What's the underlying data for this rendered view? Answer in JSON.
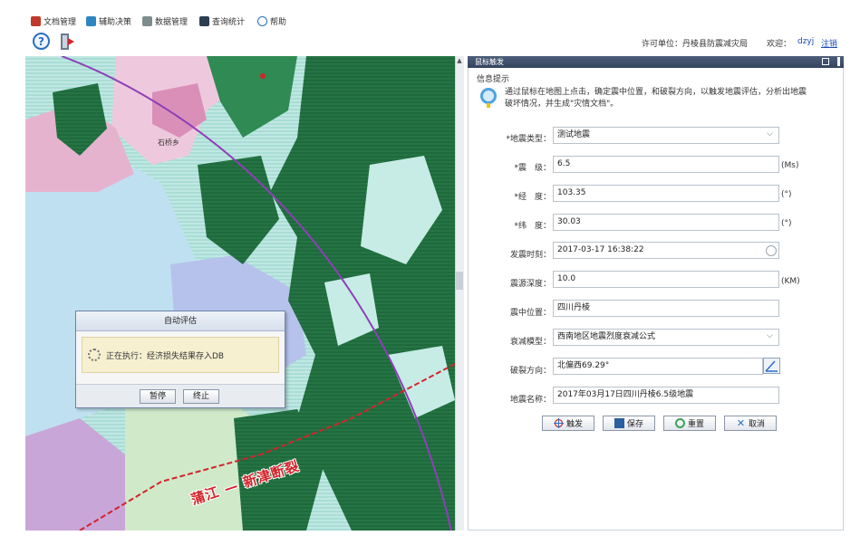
{
  "menu": [
    {
      "label": "文档管理",
      "icon": "document-icon",
      "color": "#c0392b"
    },
    {
      "label": "辅助决策",
      "icon": "decision-icon",
      "color": "#2e86c1"
    },
    {
      "label": "数据管理",
      "icon": "data-icon",
      "color": "#7f8c8d"
    },
    {
      "label": "查询统计",
      "icon": "chart-icon",
      "color": "#2c3e50"
    },
    {
      "label": "帮助",
      "icon": "help-icon",
      "color": "#2a6fc0"
    }
  ],
  "toolbar": {
    "help_glyph": "?",
    "license": "许可单位：丹棱县防震减灾局",
    "welcome": "欢迎：",
    "user": "dzyj",
    "logout": "注销"
  },
  "map": {
    "town_label": "石桥乡",
    "fault_label": "蒲江 — 新津断裂",
    "scroll_up_glyph": "▲"
  },
  "dialog": {
    "title": "自动评估",
    "status": "正在执行：经济损失结果存入DB",
    "pause": "暂停",
    "stop": "终止"
  },
  "panel": {
    "title": "鼠标触发",
    "info_title": "信息提示",
    "info_text": "通过鼠标在地图上点击，确定震中位置，和破裂方向，以触发地震评估，分析出地震破坏情况，并生成\"灾情文档\"。",
    "fields": [
      {
        "label": "*地震类型：",
        "value": "测试地震",
        "unit": "",
        "kind": "select"
      },
      {
        "label": "*震　级：",
        "value": "6.5",
        "unit": "(Ms)",
        "kind": "text"
      },
      {
        "label": "*经　度：",
        "value": "103.35",
        "unit": "(°)",
        "kind": "text"
      },
      {
        "label": "*纬　度：",
        "value": "30.03",
        "unit": "(°)",
        "kind": "text"
      },
      {
        "label": "发震时刻：",
        "value": "2017-03-17 16:38:22",
        "unit": "",
        "kind": "datetime"
      },
      {
        "label": "震源深度：",
        "value": "10.0",
        "unit": "(KM)",
        "kind": "text"
      },
      {
        "label": "震中位置：",
        "value": "四川丹棱",
        "unit": "",
        "kind": "text"
      },
      {
        "label": "衰减模型：",
        "value": "西南地区地震烈度衰减公式",
        "unit": "",
        "kind": "select"
      },
      {
        "label": "破裂方向：",
        "value": "北偏西69.29°",
        "unit": "",
        "kind": "pick"
      },
      {
        "label": "地震名称：",
        "value": "2017年03月17日四川丹棱6.5级地震",
        "unit": "",
        "kind": "text"
      }
    ],
    "buttons": {
      "trigger": "触发",
      "save": "保存",
      "reset": "重置",
      "cancel": "取消"
    },
    "chevron_glyph": "⌵"
  },
  "colors": {
    "panel_header": "#3d4e69",
    "fault_line": "#d3242b",
    "boundary_line": "#8e3fb8",
    "forest_dark": "#1f6b3e",
    "forest_light": "#bfe8e1"
  }
}
